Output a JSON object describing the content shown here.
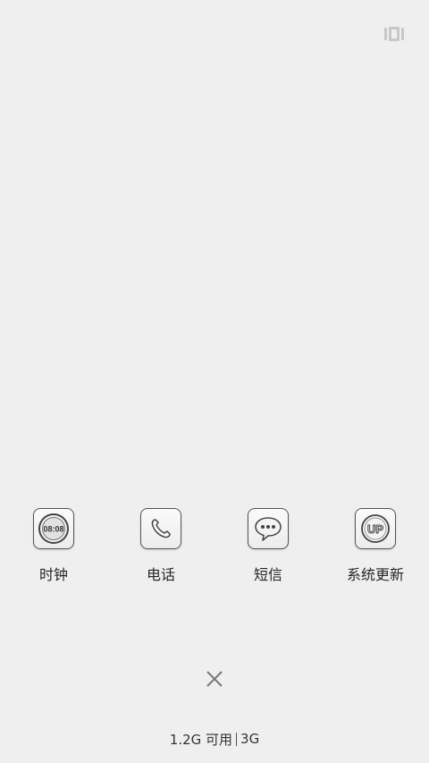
{
  "top_icon": "multi-window-icon",
  "apps": [
    {
      "label": "时钟",
      "icon": "clock-icon",
      "icon_text": "08:08"
    },
    {
      "label": "电话",
      "icon": "phone-icon"
    },
    {
      "label": "短信",
      "icon": "message-icon"
    },
    {
      "label": "系统更新",
      "icon": "system-update-icon",
      "icon_text": "UP"
    }
  ],
  "close_icon": "close-icon",
  "memory": {
    "available": "1.2G 可用",
    "network": "3G"
  }
}
